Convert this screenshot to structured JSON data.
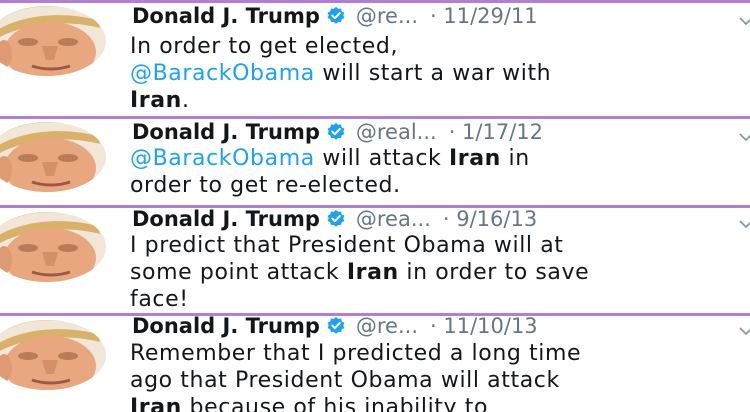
{
  "tweets": [
    {
      "name": "Donald J. Trump",
      "handle": "@re...",
      "date": "· 11/29/11",
      "lines": [
        [
          {
            "t": "In order to get elected,",
            "k": "text"
          }
        ],
        [
          {
            "t": "@BarackObama",
            "k": "mention"
          },
          {
            "t": " will start a war with",
            "k": "text"
          }
        ],
        [
          {
            "t": "Iran",
            "k": "bold"
          },
          {
            "t": ".",
            "k": "text"
          }
        ]
      ]
    },
    {
      "name": "Donald J. Trump",
      "handle": "@real...",
      "date": "· 1/17/12",
      "lines": [
        [
          {
            "t": "@BarackObama",
            "k": "mention"
          },
          {
            "t": " will attack ",
            "k": "text"
          },
          {
            "t": "Iran",
            "k": "bold"
          },
          {
            "t": " in",
            "k": "text"
          }
        ],
        [
          {
            "t": "order to get re-elected.",
            "k": "text"
          }
        ]
      ]
    },
    {
      "name": "Donald J. Trump",
      "handle": "@rea...",
      "date": "· 9/16/13",
      "lines": [
        [
          {
            "t": "I predict that President Obama will at",
            "k": "text"
          }
        ],
        [
          {
            "t": "some point attack ",
            "k": "text"
          },
          {
            "t": "Iran",
            "k": "bold"
          },
          {
            "t": " in order to save",
            "k": "text"
          }
        ],
        [
          {
            "t": "face!",
            "k": "text"
          }
        ]
      ]
    },
    {
      "name": "Donald J. Trump",
      "handle": "@re...",
      "date": "· 11/10/13",
      "lines": [
        [
          {
            "t": "Remember that I predicted a long time",
            "k": "text"
          }
        ],
        [
          {
            "t": "ago that President Obama will attack",
            "k": "text"
          }
        ],
        [
          {
            "t": "Iran",
            "k": "bold"
          },
          {
            "t": " because of his inability to",
            "k": "text"
          }
        ]
      ]
    }
  ],
  "colors": {
    "divider": "#b37fd3",
    "mention": "#1da1f2",
    "verified": "#1da1f2",
    "meta": "#657786",
    "text": "#14171a"
  },
  "icons": {
    "verified": "verified-badge-icon",
    "chevron": "chevron-down-icon",
    "avatar": "profile-photo"
  }
}
